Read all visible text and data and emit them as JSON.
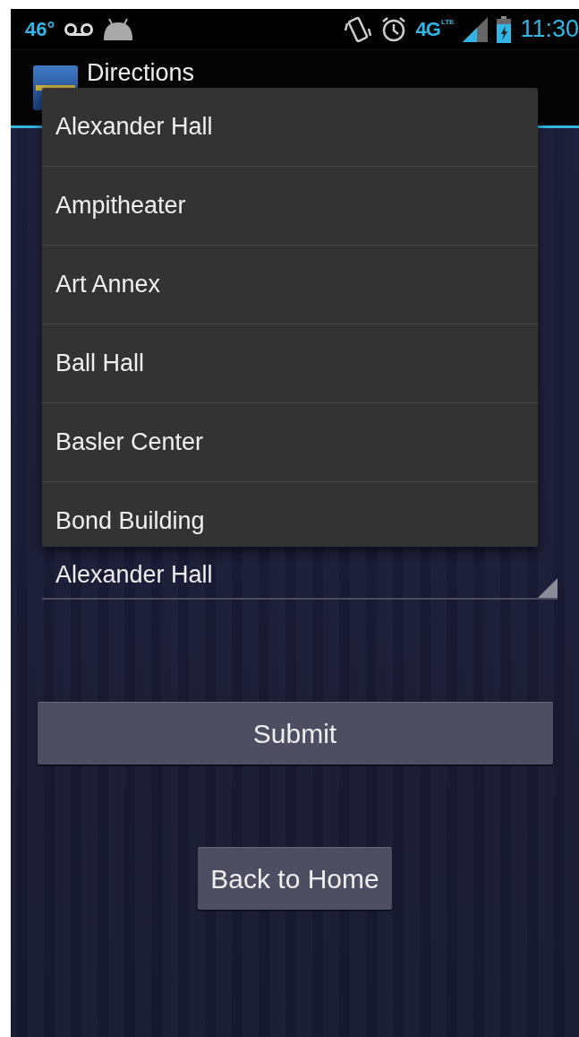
{
  "status_bar": {
    "temperature": "46°",
    "network": "4G",
    "network_sub": "LTE",
    "time": "11:30"
  },
  "action_bar": {
    "title": "Directions"
  },
  "dropdown": {
    "items": [
      {
        "label": "Alexander Hall",
        "selected": false
      },
      {
        "label": "Ampitheater",
        "selected": false
      },
      {
        "label": "Art Annex",
        "selected": false
      },
      {
        "label": "Ball Hall",
        "selected": false
      },
      {
        "label": "Basler Center",
        "selected": false
      },
      {
        "label": "Bond Building",
        "selected": false
      }
    ]
  },
  "spinner": {
    "value": "Alexander Hall"
  },
  "buttons": [
    {
      "label": "Submit",
      "kind": "wide"
    },
    {
      "label": "Back to Home",
      "kind": "compact"
    }
  ]
}
